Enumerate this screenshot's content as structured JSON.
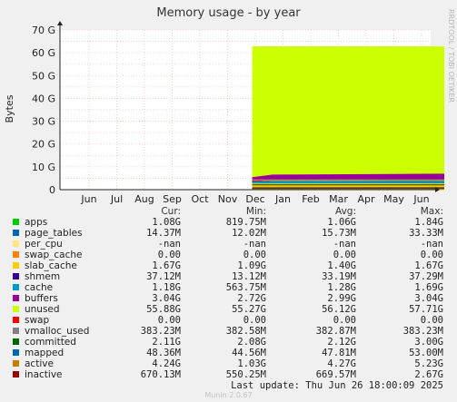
{
  "window": {
    "title": "Memory usage - by year"
  },
  "chart_data": {
    "type": "area",
    "title": "Memory usage - by year",
    "ylabel": "Bytes",
    "ylim": [
      0,
      70
    ],
    "y_unit": "G",
    "y_ticks": [
      "0",
      "10 G",
      "20 G",
      "30 G",
      "40 G",
      "50 G",
      "60 G",
      "70 G"
    ],
    "x_ticks": [
      "Jun",
      "Jul",
      "Aug",
      "Sep",
      "Oct",
      "Nov",
      "Dec",
      "Jan",
      "Feb",
      "Mar",
      "Apr",
      "May",
      "Jun"
    ],
    "x_start": "2024-06",
    "data_start": "2024-11-28",
    "stack_order": [
      "apps",
      "page_tables",
      "per_cpu",
      "swap_cache",
      "slab_cache",
      "shmem",
      "cache",
      "buffers",
      "unused",
      "swap"
    ],
    "series_top_g": [
      {
        "name": "apps",
        "color": "#00cc00",
        "values": [
          {
            "date": "2024-11-28",
            "top": 1.0
          },
          {
            "date": "2025-06-26",
            "top": 1.0
          }
        ]
      },
      {
        "name": "page_tables",
        "color": "#0066b3",
        "values": [
          {
            "date": "2024-11-28",
            "top": 1.1
          },
          {
            "date": "2025-06-26",
            "top": 1.1
          }
        ]
      },
      {
        "name": "slab_cache",
        "color": "#ffcc00",
        "values": [
          {
            "date": "2024-11-28",
            "top": 2.7
          },
          {
            "date": "2025-06-26",
            "top": 2.8
          }
        ]
      },
      {
        "name": "shmem",
        "color": "#330099",
        "values": [
          {
            "date": "2024-11-28",
            "top": 2.8
          },
          {
            "date": "2025-06-26",
            "top": 2.9
          }
        ]
      },
      {
        "name": "cache",
        "color": "#0099cc",
        "values": [
          {
            "date": "2024-11-28",
            "top": 3.4
          },
          {
            "date": "2024-12-20",
            "top": 3.9
          },
          {
            "date": "2025-06-26",
            "top": 4.0
          }
        ]
      },
      {
        "name": "buffers",
        "color": "#990099",
        "values": [
          {
            "date": "2024-11-28",
            "top": 5.5
          },
          {
            "date": "2024-12-20",
            "top": 6.6
          },
          {
            "date": "2025-06-26",
            "top": 7.0
          }
        ]
      },
      {
        "name": "unused",
        "color": "#ccff00",
        "values": [
          {
            "date": "2024-11-28",
            "top": 62.8
          },
          {
            "date": "2025-06-26",
            "top": 62.8
          }
        ]
      }
    ],
    "overlay_lines": [
      {
        "name": "committed",
        "color": "#006600",
        "values": [
          {
            "date": "2024-11-28",
            "g": 2.1
          },
          {
            "date": "2025-06-26",
            "g": 2.1
          }
        ]
      },
      {
        "name": "mapped",
        "color": "#cc7a00",
        "values": [
          {
            "date": "2024-11-28",
            "g": 0.1
          },
          {
            "date": "2025-06-26",
            "g": 0.1
          }
        ]
      },
      {
        "name": "active",
        "color": "#cc9900",
        "values": [
          {
            "date": "2024-11-28",
            "g": 4.2
          },
          {
            "date": "2025-06-26",
            "g": 4.2
          }
        ]
      },
      {
        "name": "inactive",
        "color": "#990000",
        "values": [
          {
            "date": "2024-11-28",
            "g": 0.7
          },
          {
            "date": "2025-06-26",
            "g": 0.7
          }
        ]
      }
    ]
  },
  "legend": {
    "headers": {
      "cur": "Cur:",
      "min": "Min:",
      "avg": "Avg:",
      "max": "Max:"
    },
    "rows": [
      {
        "name": "apps",
        "color": "#00cc00",
        "cur": "1.08G",
        "min": "819.75M",
        "avg": "1.06G",
        "max": "1.84G"
      },
      {
        "name": "page_tables",
        "color": "#0066b3",
        "cur": "14.37M",
        "min": "12.02M",
        "avg": "15.73M",
        "max": "33.33M"
      },
      {
        "name": "per_cpu",
        "color": "#ffe680",
        "cur": "-nan",
        "min": "-nan",
        "avg": "-nan",
        "max": "-nan"
      },
      {
        "name": "swap_cache",
        "color": "#ff8000",
        "cur": "0.00",
        "min": "0.00",
        "avg": "0.00",
        "max": "0.00"
      },
      {
        "name": "slab_cache",
        "color": "#ffcc00",
        "cur": "1.67G",
        "min": "1.09G",
        "avg": "1.40G",
        "max": "1.67G"
      },
      {
        "name": "shmem",
        "color": "#330099",
        "cur": "37.12M",
        "min": "13.12M",
        "avg": "33.19M",
        "max": "37.29M"
      },
      {
        "name": "cache",
        "color": "#0099cc",
        "cur": "1.18G",
        "min": "563.75M",
        "avg": "1.28G",
        "max": "1.69G"
      },
      {
        "name": "buffers",
        "color": "#990099",
        "cur": "3.04G",
        "min": "2.72G",
        "avg": "2.99G",
        "max": "3.04G"
      },
      {
        "name": "unused",
        "color": "#ccff00",
        "cur": "55.88G",
        "min": "55.27G",
        "avg": "56.12G",
        "max": "57.71G"
      },
      {
        "name": "swap",
        "color": "#ff0000",
        "cur": "0.00",
        "min": "0.00",
        "avg": "0.00",
        "max": "0.00"
      },
      {
        "name": "vmalloc_used",
        "color": "#808080",
        "cur": "383.23M",
        "min": "382.58M",
        "avg": "382.87M",
        "max": "383.23M"
      },
      {
        "name": "committed",
        "color": "#006600",
        "cur": "2.11G",
        "min": "2.08G",
        "avg": "2.12G",
        "max": "3.00G"
      },
      {
        "name": "mapped",
        "color": "#0066b3",
        "cur": "48.36M",
        "min": "44.56M",
        "avg": "47.81M",
        "max": "53.00M"
      },
      {
        "name": "active",
        "color": "#cc7a00",
        "cur": "4.24G",
        "min": "1.03G",
        "avg": "4.27G",
        "max": "5.23G"
      },
      {
        "name": "inactive",
        "color": "#990000",
        "cur": "670.13M",
        "min": "550.25M",
        "avg": "669.57M",
        "max": "2.67G"
      }
    ]
  },
  "footer": {
    "last_update": "Last update: Thu Jun 26 18:00:09 2025",
    "munin": "Munin 2.0.67",
    "watermark": "RRDTOOL / TOBI OETIKER"
  }
}
